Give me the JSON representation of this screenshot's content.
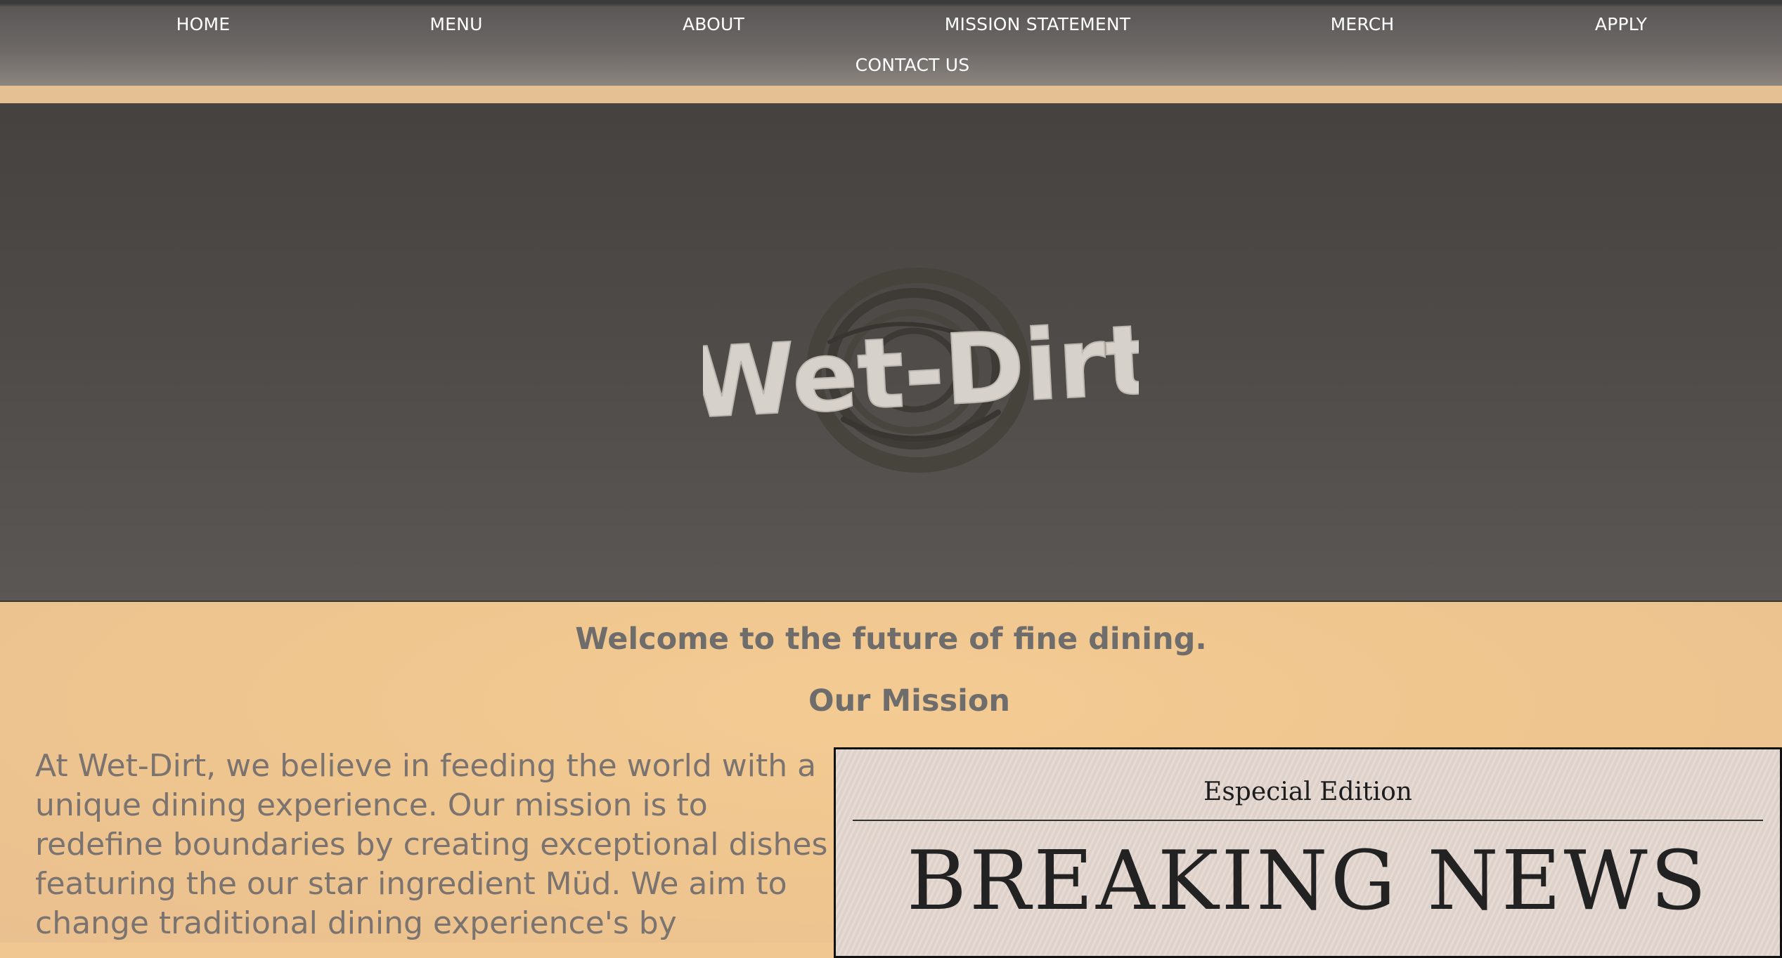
{
  "nav": {
    "items": [
      {
        "label": "HOME"
      },
      {
        "label": "MENU"
      },
      {
        "label": "ABOUT"
      },
      {
        "label": "MISSION STATEMENT"
      },
      {
        "label": "MERCH"
      },
      {
        "label": "APPLY"
      },
      {
        "label": "CONTACT US"
      }
    ]
  },
  "hero": {
    "logo_text": "Wet-Dirt"
  },
  "content": {
    "welcome": "Welcome to the future of fine dining.",
    "mission_title": "Our Mission",
    "mission_text": "At Wet-Dirt, we believe in feeding the world with a unique dining experience. Our mission is to redefine boundaries by creating exceptional dishes featuring the our star ingredient Müd. We aim to change traditional dining experience's by"
  },
  "news": {
    "edition": "Especial Edition",
    "headline": "BREAKING NEWS"
  },
  "colors": {
    "nav_text": "#ffffff",
    "page_bg": "#f0c790",
    "hero_bg": "#4f4b49",
    "heading_text": "#6f6d6c",
    "body_text": "#7a7370"
  }
}
